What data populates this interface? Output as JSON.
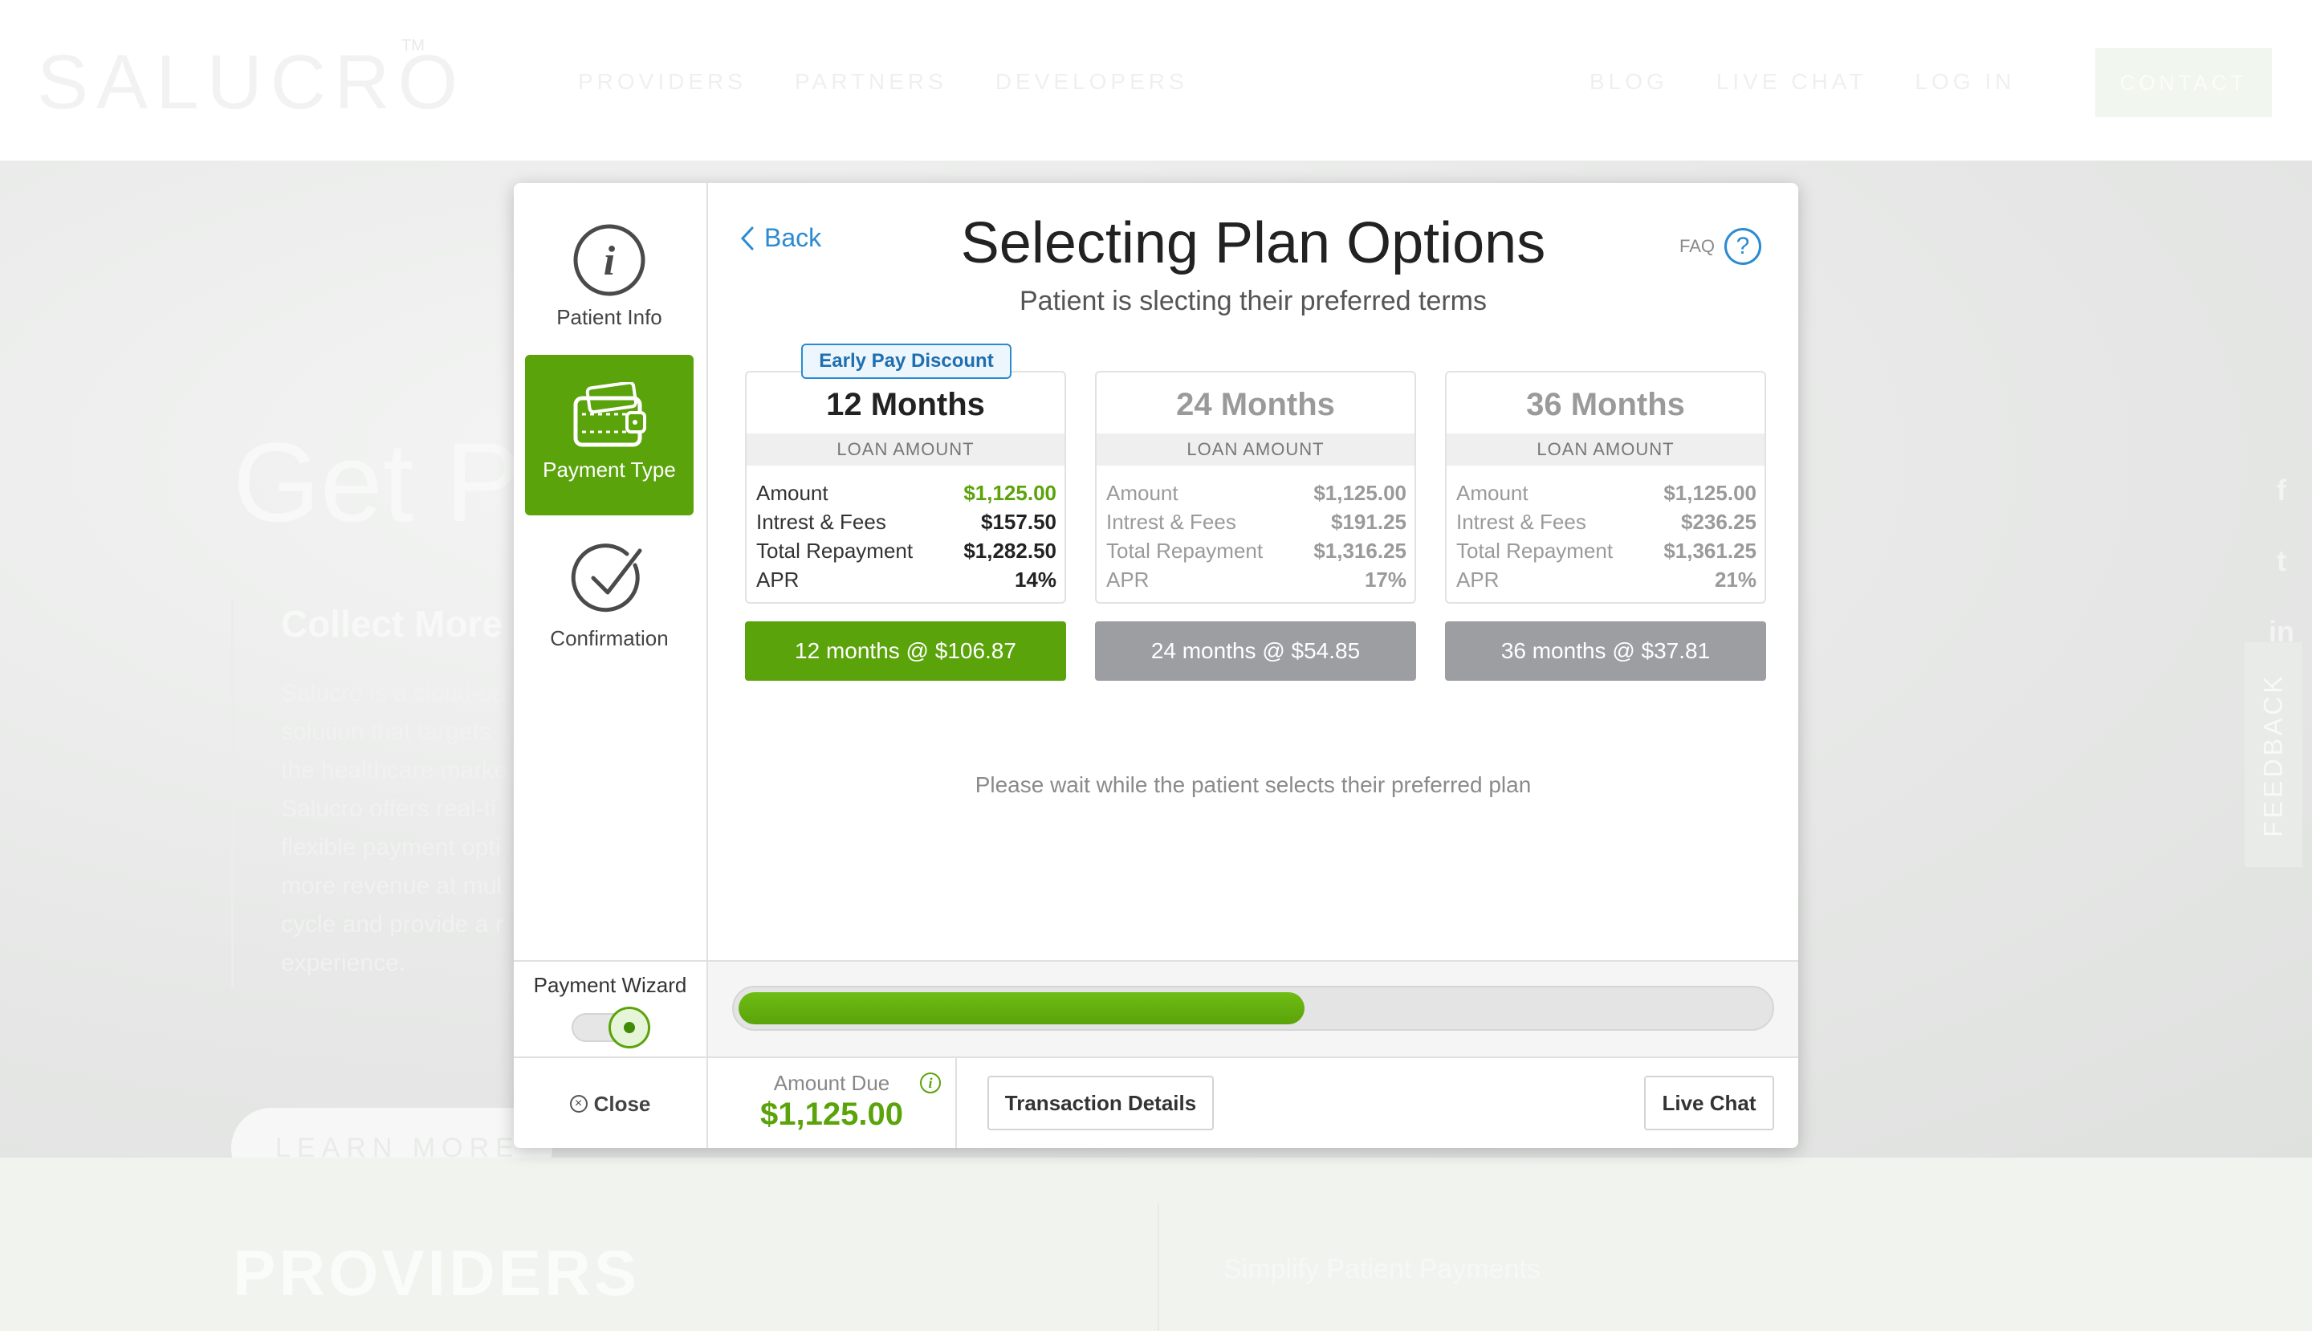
{
  "site": {
    "logo": "SALUCRO",
    "logo_tm": "TM",
    "nav_main": [
      "PROVIDERS",
      "PARTNERS",
      "DEVELOPERS"
    ],
    "nav_right": [
      "BLOG",
      "LIVE CHAT",
      "LOG IN"
    ],
    "contact": "CONTACT",
    "hero_title": "Get Pa",
    "hero_subtitle": "Collect More",
    "hero_body": [
      "Salucro is a cloud-ba",
      "solution that targets",
      "the healthcare marke",
      "Salucro offers real-ti",
      "flexible payment opti",
      "more revenue at mul",
      "cycle and provide a r",
      "experience."
    ],
    "learn_more": "LEARN MORE",
    "providers": "PROVIDERS",
    "simplify": "Simplify Patient Payments",
    "social": [
      "f",
      "t",
      "in"
    ],
    "feedback": "FEEDBACK"
  },
  "wizard": {
    "steps": [
      {
        "label": "Patient Info",
        "icon": "info-icon"
      },
      {
        "label": "Payment Type",
        "icon": "wallet-icon",
        "active": true
      },
      {
        "label": "Confirmation",
        "icon": "check-circle-icon"
      }
    ],
    "back": "Back",
    "title": "Selecting Plan Options",
    "subtitle": "Patient is slecting their preferred terms",
    "faq": "FAQ",
    "faq_icon": "?",
    "discount_badge": "Early Pay Discount",
    "plans": [
      {
        "title": "12 Months",
        "loan_label": "LOAN AMOUNT",
        "rows": [
          {
            "label": "Amount",
            "value": "$1,125.00"
          },
          {
            "label": "Intrest & Fees",
            "value": "$157.50"
          },
          {
            "label": "Total Repayment",
            "value": "$1,282.50"
          },
          {
            "label": "APR",
            "value": "14%"
          }
        ],
        "button": "12 months @ $106.87",
        "selected": true
      },
      {
        "title": "24 Months",
        "loan_label": "LOAN AMOUNT",
        "rows": [
          {
            "label": "Amount",
            "value": "$1,125.00"
          },
          {
            "label": "Intrest & Fees",
            "value": "$191.25"
          },
          {
            "label": "Total Repayment",
            "value": "$1,316.25"
          },
          {
            "label": "APR",
            "value": "17%"
          }
        ],
        "button": "24 months @ $54.85",
        "selected": false
      },
      {
        "title": "36 Months",
        "loan_label": "LOAN AMOUNT",
        "rows": [
          {
            "label": "Amount",
            "value": "$1,125.00"
          },
          {
            "label": "Intrest & Fees",
            "value": "$236.25"
          },
          {
            "label": "Total Repayment",
            "value": "$1,361.25"
          },
          {
            "label": "APR",
            "value": "21%"
          }
        ],
        "button": "36 months @ $37.81",
        "selected": false
      }
    ],
    "wait_message": "Please wait while the patient selects their preferred plan",
    "payment_wizard_label": "Payment Wizard",
    "payment_wizard_on": true,
    "progress": 0.55,
    "close": "Close",
    "amount_due_label": "Amount Due",
    "amount_due": "$1,125.00",
    "transaction_details": "Transaction Details",
    "live_chat": "Live Chat"
  },
  "colors": {
    "accent_green": "#5aa30a",
    "link_blue": "#2a8ad2",
    "inactive_gray": "#9c9ea2"
  }
}
